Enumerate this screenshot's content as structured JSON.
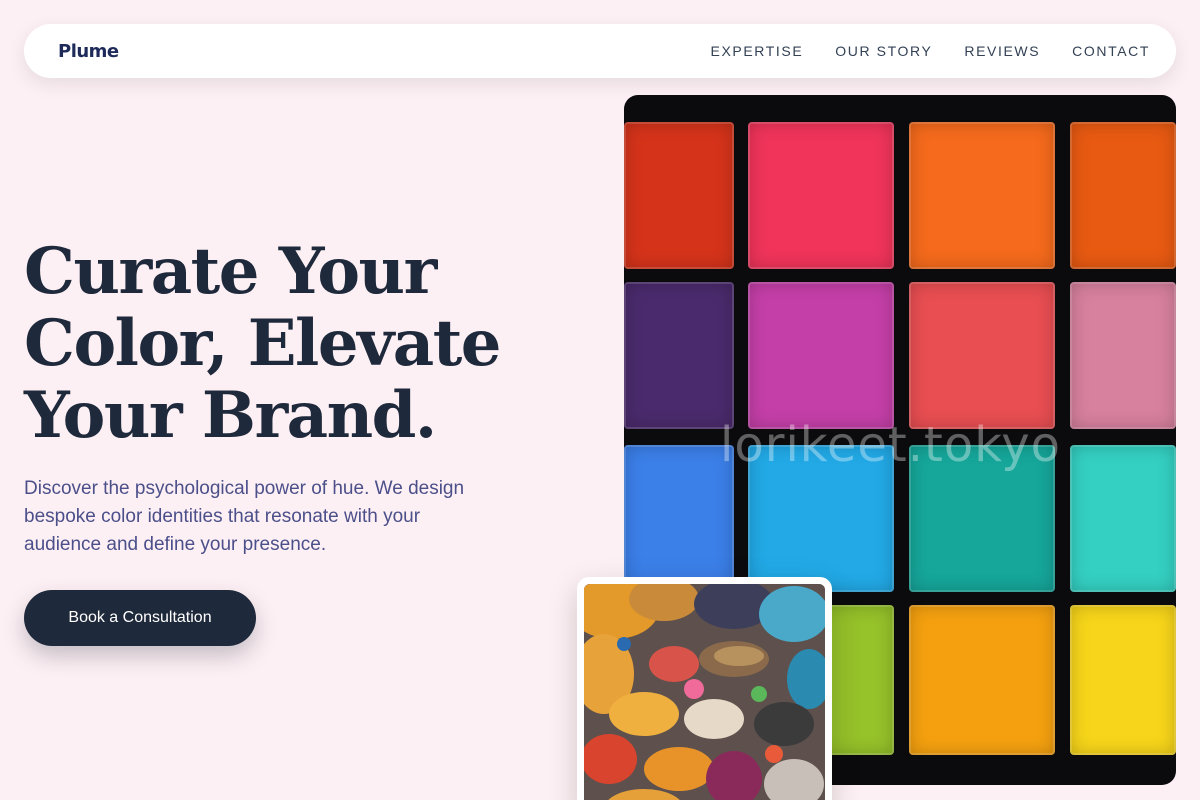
{
  "brand": {
    "logo": "Plume"
  },
  "nav": {
    "links": [
      "EXPERTISE",
      "OUR STORY",
      "REVIEWS",
      "CONTACT"
    ]
  },
  "hero": {
    "headline_lines": [
      "Curate Your",
      "Color, Elevate",
      "Your Brand."
    ],
    "subtext": "Discover the psychological power of hue. We design bespoke color identities that resonate with your audience and define your presence.",
    "cta_label": "Book a Consultation"
  },
  "palette_image": {
    "watermark": "lorikeet.tokyo",
    "pan_colors": [
      [
        "#d5331a",
        "#f0345a",
        "#f56a1c",
        "#e85a12"
      ],
      [
        "#4a2a6c",
        "#c43fa8",
        "#e84e52",
        "#d7819e"
      ],
      [
        "#3b7fe8",
        "#22a9e6",
        "#16a69a",
        "#34d0c2"
      ],
      [
        "#f0a60c",
        "#96c22a",
        "#f5a10f",
        "#f7d51a"
      ]
    ]
  },
  "paint_image": {
    "icon": "paint-palette-photo"
  },
  "colors": {
    "background": "#fdf0f4",
    "primary": "#1e293b",
    "subtext": "#4b4f8a",
    "logo": "#1e2a5a"
  }
}
